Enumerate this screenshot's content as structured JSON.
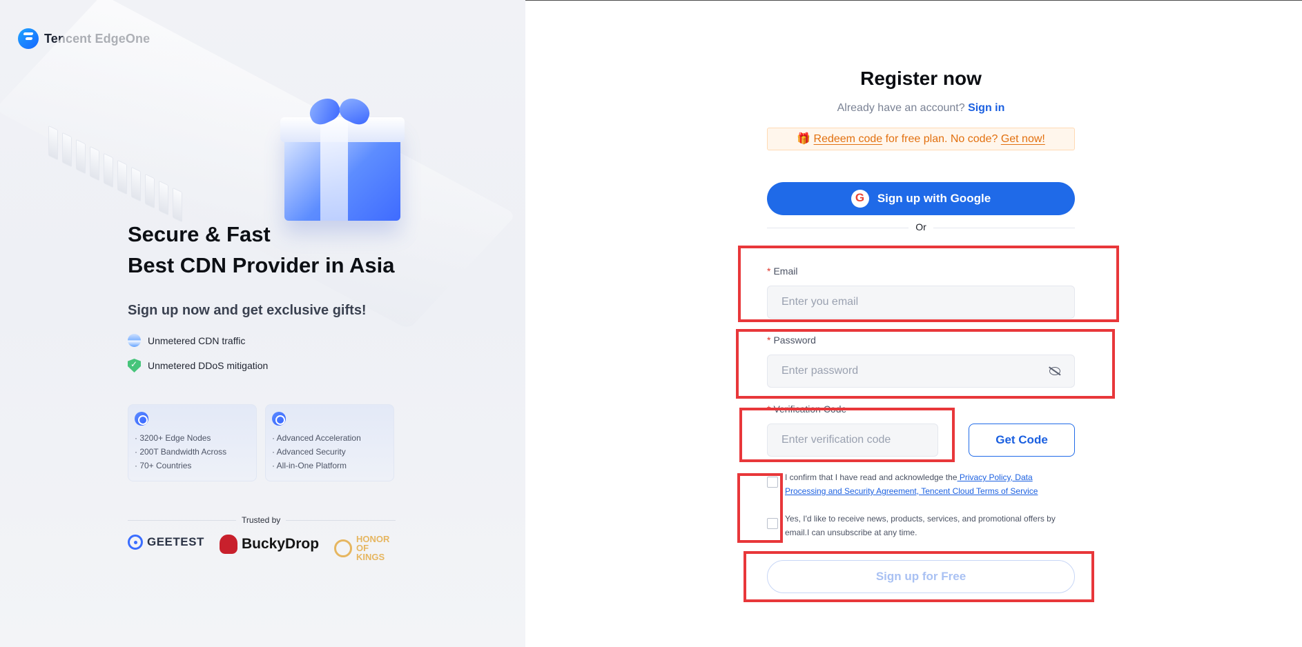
{
  "brand": {
    "name": "Tencent EdgeOne"
  },
  "hero": {
    "title_line1": "Secure & Fast",
    "title_line2": "Best CDN Provider in Asia",
    "subtitle": "Sign up now and get exclusive gifts!",
    "features": [
      {
        "icon": "cdn-traffic-icon",
        "label": "Unmetered CDN traffic"
      },
      {
        "icon": "shield-check-icon",
        "label": "Unmetered DDoS mitigation"
      }
    ],
    "cards": [
      {
        "icon": "globe-nodes-icon",
        "lines": [
          "· 3200+ Edge Nodes",
          "· 200T Bandwidth Across",
          "· 70+ Countries"
        ]
      },
      {
        "icon": "settings-gear-icon",
        "lines": [
          "· Advanced Acceleration",
          "· Advanced Security",
          "· All-in-One Platform"
        ]
      }
    ],
    "trusted_label": "Trusted by",
    "logos": [
      "GEETEST",
      "BuckyDrop",
      "HONOR OF KINGS"
    ]
  },
  "form": {
    "title": "Register now",
    "already_text": "Already have an account?",
    "signin_label": "Sign in",
    "redeem": {
      "code_link": "Redeem code",
      "middle_text": " for free plan. No code? ",
      "get_link": "Get now!"
    },
    "google_label": "Sign up with Google",
    "or_label": "Or",
    "email": {
      "label": "Email",
      "placeholder": "Enter you email"
    },
    "password": {
      "label": "Password",
      "placeholder": "Enter password"
    },
    "code": {
      "label": "Verification Code",
      "placeholder": "Enter verification code",
      "button": "Get Code"
    },
    "consent1": {
      "text": "I confirm that I have read and acknowledge the",
      "link": " Privacy Policy, Data Processing and Security Agreement, Tencent Cloud Terms of Service"
    },
    "consent2": {
      "text": "Yes, I'd like to receive news, products, services, and promotional offers by email.I can unsubscribe at any time."
    },
    "submit_label": "Sign up for Free"
  },
  "colors": {
    "primary": "#1f6ae8",
    "highlight": "#e8373a",
    "redeem_text": "#e2700f",
    "required": "#e0352b"
  }
}
